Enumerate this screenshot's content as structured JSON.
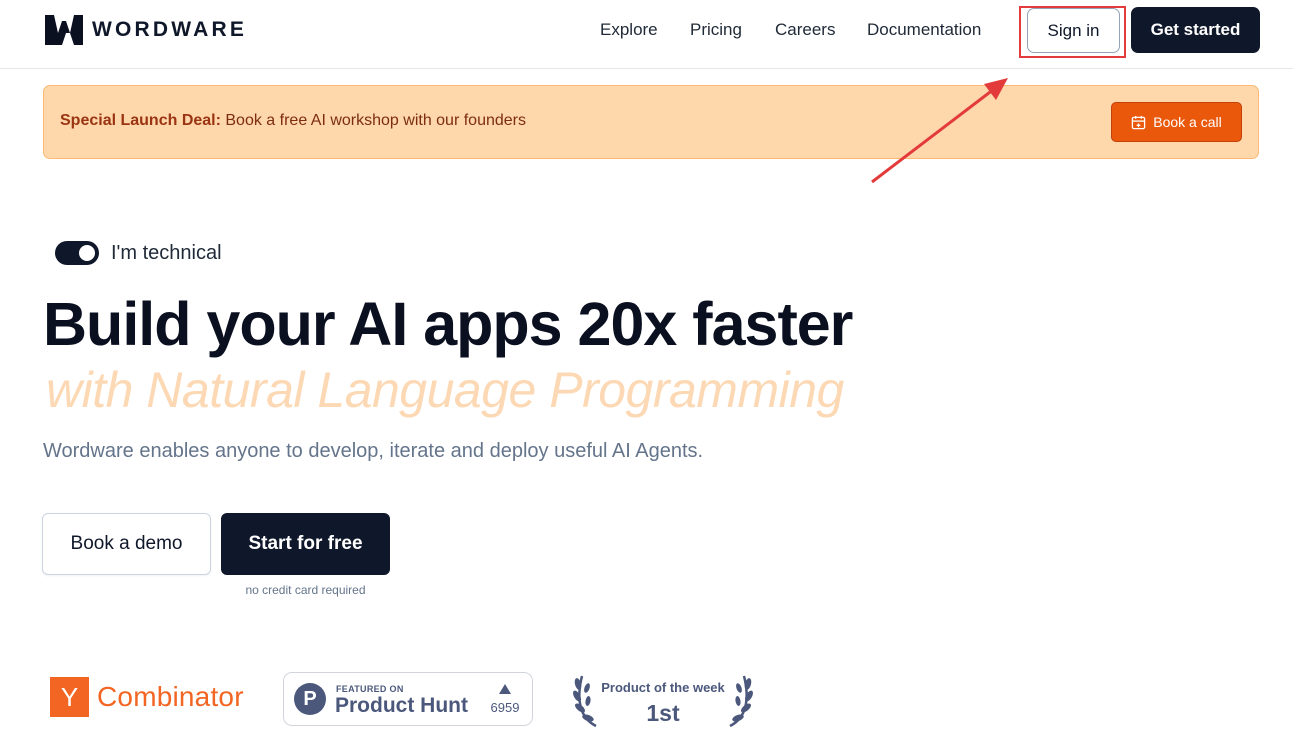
{
  "header": {
    "logo_text": "WORDWARE",
    "nav": [
      "Explore",
      "Pricing",
      "Careers",
      "Documentation"
    ],
    "signin_label": "Sign in",
    "get_started_label": "Get started"
  },
  "banner": {
    "bold_text": "Special Launch Deal:",
    "text": " Book a free AI workshop with our founders",
    "button_label": "Book a call"
  },
  "toggle": {
    "label": "I'm technical",
    "on": true
  },
  "hero": {
    "title": "Build your AI apps 20x faster",
    "subtitle": "with Natural Language Programming",
    "description": "Wordware enables anyone to develop, iterate and deploy useful AI Agents."
  },
  "cta": {
    "demo_label": "Book a demo",
    "free_label": "Start for free",
    "note": "no credit card required"
  },
  "badges": {
    "yc_letter": "Y",
    "yc_text": "Combinator",
    "ph_featured": "FEATURED ON",
    "ph_name": "Product Hunt",
    "ph_letter": "P",
    "ph_count": "6959",
    "potw_text": "Product of the week",
    "potw_rank": "1st"
  },
  "colors": {
    "primary": "#0f172a",
    "accent_orange": "#ea580c",
    "banner_bg": "#fed7aa",
    "annotation_red": "#e33b3b"
  },
  "icons": [
    "wordware-logo-icon",
    "calendar-icon",
    "product-hunt-icon",
    "laurel-icon",
    "upvote-arrow-icon"
  ]
}
